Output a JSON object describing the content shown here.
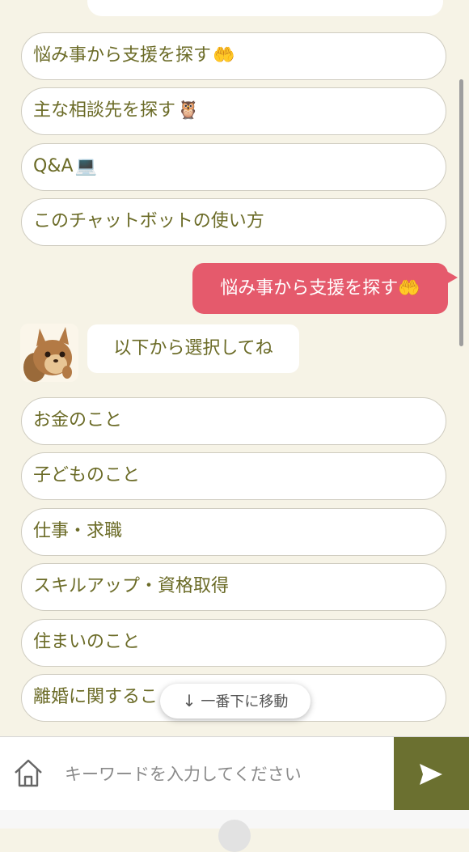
{
  "menu_options": [
    {
      "label": "悩み事から支援を探す",
      "emoji": "🤲"
    },
    {
      "label": "主な相談先を探す",
      "emoji": "🦉"
    },
    {
      "label": "Q&A",
      "emoji": "💻"
    },
    {
      "label": "このチャットボットの使い方",
      "emoji": ""
    }
  ],
  "user_message": {
    "text": "悩み事から支援を探す",
    "emoji": "🤲"
  },
  "bot_message": {
    "text": "以下から選択してね"
  },
  "sub_options": [
    {
      "label": "お金のこと"
    },
    {
      "label": "子どものこと"
    },
    {
      "label": "仕事・求職"
    },
    {
      "label": "スキルアップ・資格取得"
    },
    {
      "label": "住まいのこと"
    },
    {
      "label": "離婚に関するこ"
    }
  ],
  "jump_button": {
    "arrow": "↓",
    "label": "一番下に移動"
  },
  "input": {
    "placeholder": "キーワードを入力してください",
    "value": ""
  },
  "icons": {
    "home": "home-icon",
    "send": "send-icon",
    "avatar": "squirrel-avatar"
  },
  "colors": {
    "background": "#f6f3e6",
    "option_text": "#6b6b27",
    "user_bubble": "#e55a6c",
    "send_button": "#6b7030"
  }
}
